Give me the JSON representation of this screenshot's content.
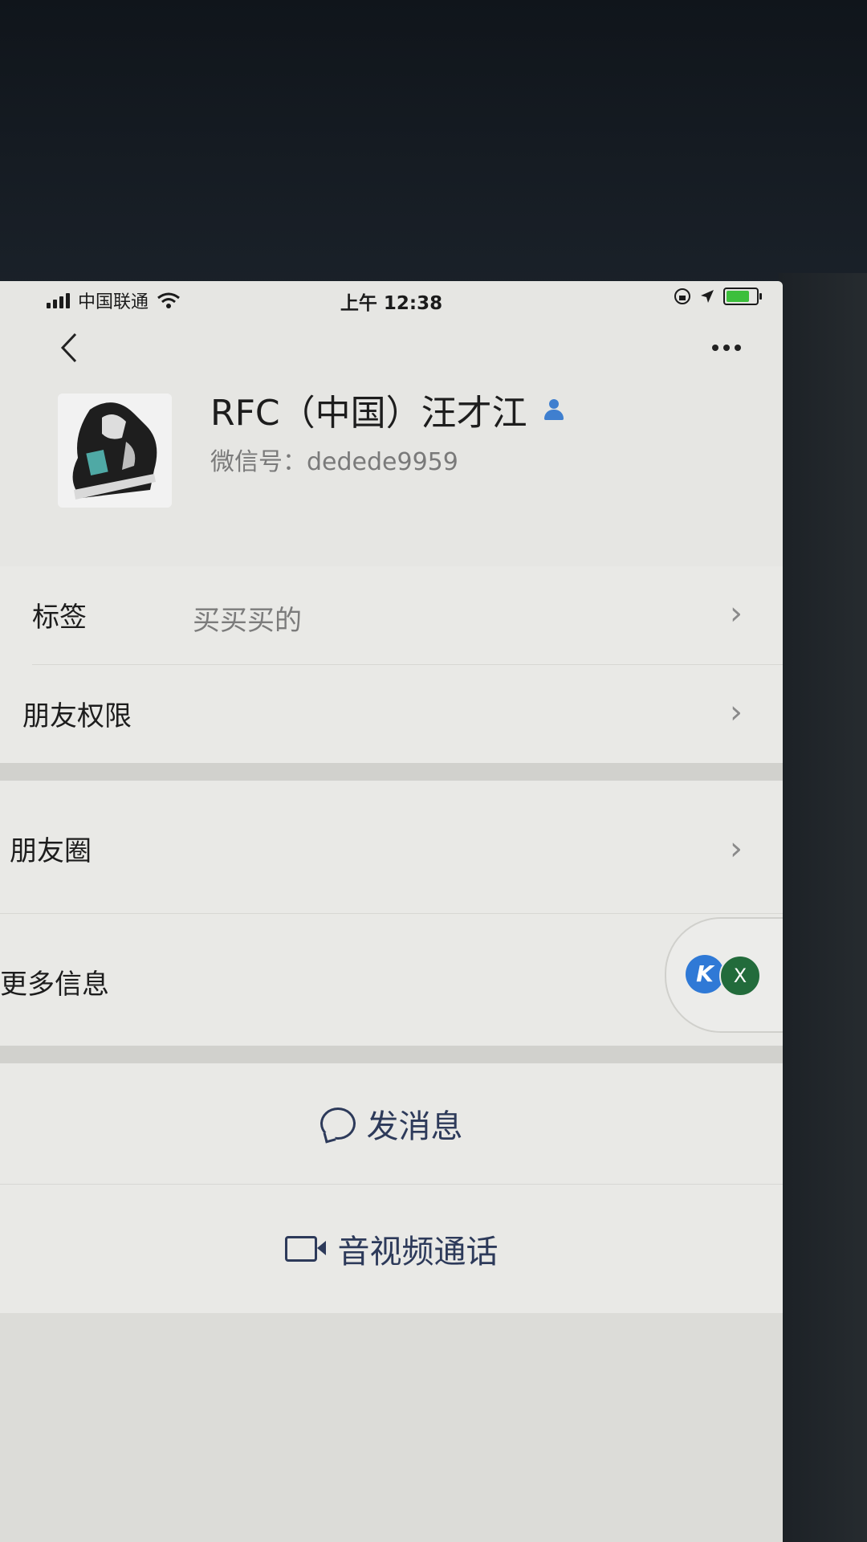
{
  "status_bar": {
    "carrier": "中国联通",
    "time": "上午 12:38"
  },
  "profile": {
    "name": "RFC（中国）汪才江",
    "wechat_id": "微信号：dedede9959"
  },
  "rows": {
    "tags_label": "标签",
    "tags_value": "买买买的",
    "friend_permission_label": "朋友权限",
    "moments_label": "朋友圈",
    "more_info_label": "更多信息"
  },
  "actions": {
    "send_message": "发消息",
    "av_call": "音视频通话"
  },
  "floating": {
    "close_label": "X"
  },
  "colors": {
    "accent_link": "#2d3a5a",
    "verified_icon": "#3f7fcf",
    "battery": "#3cbf3c"
  },
  "icons": [
    "back-icon",
    "more-icon",
    "person-icon",
    "chevron-right-icon",
    "chat-bubble-icon",
    "video-camera-icon"
  ]
}
